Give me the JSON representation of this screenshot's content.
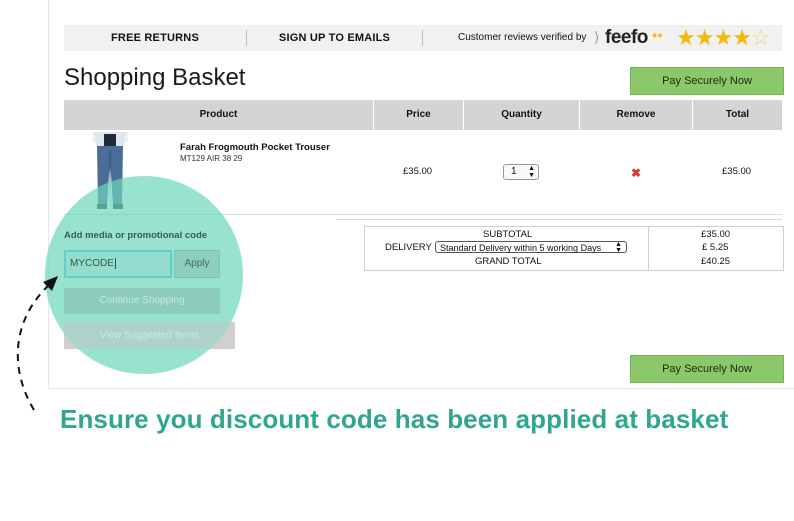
{
  "topbar": {
    "free_returns": "FREE RETURNS",
    "sign_up": "SIGN UP TO EMAILS",
    "reviews": "Customer reviews verified by",
    "feefo_logo": "feefo",
    "rating_stars": 4.5
  },
  "page": {
    "title": "Shopping Basket",
    "pay_button": "Pay Securely Now"
  },
  "table": {
    "headers": [
      "Product",
      "Price",
      "Quantity",
      "Remove",
      "Total"
    ],
    "row": {
      "name": "Farah Frogmouth Pocket Trouser",
      "code": "MT129 AIR 38 29",
      "price": "£35.00",
      "quantity": "1",
      "remove_icon": "remove-x-icon",
      "total": "£35.00"
    }
  },
  "summary": {
    "subtotal_label": "SUBTOTAL",
    "subtotal_value": "£35.00",
    "delivery_label": "DELIVERY",
    "delivery_option": "Standard Delivery within 5 working Days",
    "delivery_value": "£ 5.25",
    "grand_total_label": "GRAND TOTAL",
    "grand_total_value": "£40.25"
  },
  "promo": {
    "label": "Add media or promotional code",
    "value": "MYCODE",
    "apply_button": "Apply",
    "continue_button": "Continue Shopping",
    "suggested_button": "View Suggested Items"
  },
  "caption": "Ensure you discount code has been applied at basket",
  "colors": {
    "pay_green": "#8ac86a",
    "highlight": "#6ed6be",
    "caption": "#2fa68f",
    "remove_red": "#d23b3b",
    "stars": "#f5b80c"
  }
}
